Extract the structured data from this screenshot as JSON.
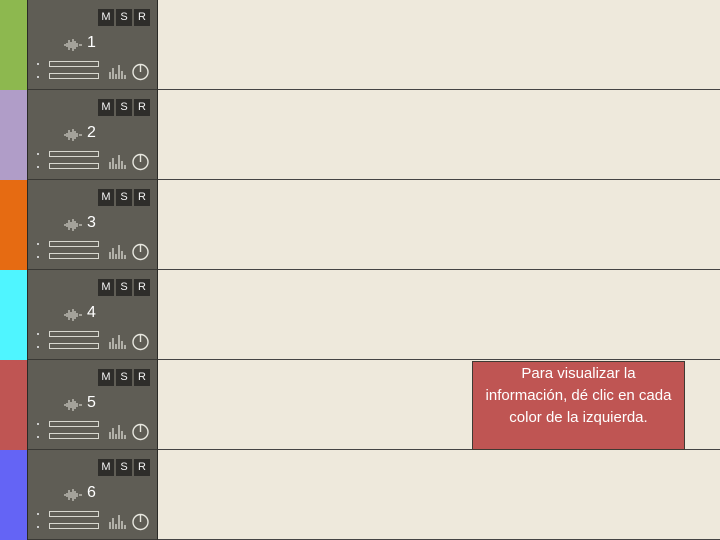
{
  "tracks": [
    {
      "number": "1",
      "color": "#8db84f",
      "mute_label": "M",
      "solo_label": "S",
      "record_label": "R"
    },
    {
      "number": "2",
      "color": "#b09dc8",
      "mute_label": "M",
      "solo_label": "S",
      "record_label": "R"
    },
    {
      "number": "3",
      "color": "#e66b12",
      "mute_label": "M",
      "solo_label": "S",
      "record_label": "R"
    },
    {
      "number": "4",
      "color": "#4ff5ff",
      "mute_label": "M",
      "solo_label": "S",
      "record_label": "R"
    },
    {
      "number": "5",
      "color": "#bf5553",
      "mute_label": "M",
      "solo_label": "S",
      "record_label": "R"
    },
    {
      "number": "6",
      "color": "#6464f5",
      "mute_label": "M",
      "solo_label": "S",
      "record_label": "R"
    }
  ],
  "icons": {
    "track_type": "waveform-icon",
    "meter": "level-meter-icon",
    "power": "power-icon"
  },
  "tooltip": {
    "text": "Para visualizar la información, dé clic en cada color de la izquierda.",
    "background": "#bf5553"
  }
}
